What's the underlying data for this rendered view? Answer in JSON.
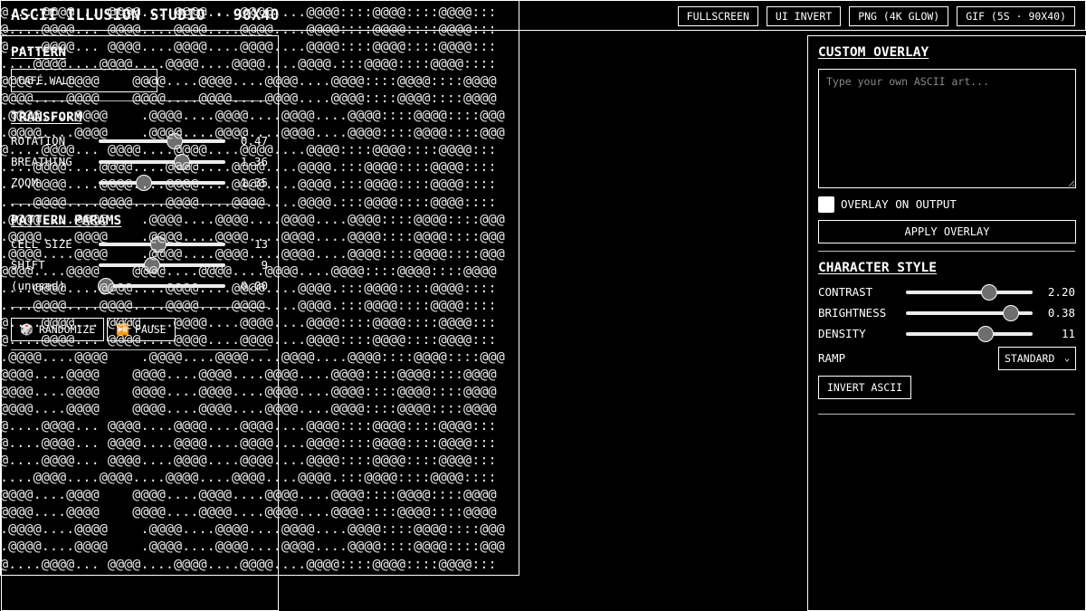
{
  "app": {
    "title": "ASCII ILLUSION STUDIO · 90X40"
  },
  "toolbar": {
    "fullscreen": "FULLSCREEN",
    "ui_invert": "UI INVERT",
    "png": "PNG (4K GLOW)",
    "gif": "GIF (5S · 90X40)"
  },
  "left": {
    "pattern": {
      "title": "PATTERN",
      "selected": "CAFÉ WALL"
    },
    "transform": {
      "title": "TRANSFORM",
      "rows": [
        {
          "label": "ROTATION",
          "value": "0.47",
          "fraction": 0.6
        },
        {
          "label": "BREATHING",
          "value": "1.36",
          "fraction": 0.66
        },
        {
          "label": "ZOOM",
          "value": "1.35",
          "fraction": 0.36
        }
      ]
    },
    "params": {
      "title": "PATTERN PARAMS",
      "rows": [
        {
          "label": "CELL SIZE",
          "value": "13",
          "fraction": 0.47
        },
        {
          "label": "SHIFT",
          "value": "9",
          "fraction": 0.42
        },
        {
          "label": "(unused)",
          "value": "0.00",
          "fraction": 0.06
        }
      ]
    },
    "actions": {
      "randomize": "RANDOMIZE",
      "randomize_icon": "🎲",
      "pause": "PAUSE",
      "pause_icon": "⏯️"
    }
  },
  "canvas": {
    "lines": [
      "@....@@@@... @@@@....@@@@....@@@@....@@@@::::@@@@::::@@@@:::",
      "@....@@@@... @@@@....@@@@....@@@@....@@@@::::@@@@::::@@@@:::",
      "@....@@@@... @@@@....@@@@....@@@@....@@@@::::@@@@::::@@@@:::",
      "....@@@@....@@@@....@@@@....@@@@....@@@@.:::@@@@::::@@@@::::",
      "@@@@....@@@@    @@@@....@@@@....@@@@....@@@@::::@@@@::::@@@@",
      "@@@@....@@@@    @@@@....@@@@....@@@@....@@@@::::@@@@::::@@@@",
      ".@@@@....@@@@    .@@@@....@@@@....@@@@....@@@@::::@@@@::::@@@",
      ".@@@@....@@@@    .@@@@....@@@@....@@@@....@@@@::::@@@@::::@@@",
      "@....@@@@... @@@@....@@@@....@@@@....@@@@::::@@@@::::@@@@:::",
      "....@@@@....@@@@....@@@@....@@@@....@@@@.:::@@@@::::@@@@::::",
      "....@@@@....@@@@....@@@@....@@@@....@@@@.:::@@@@::::@@@@::::",
      "....@@@@....@@@@....@@@@....@@@@....@@@@.:::@@@@::::@@@@::::",
      ".@@@@....@@@@    .@@@@....@@@@....@@@@....@@@@::::@@@@::::@@@",
      ".@@@@....@@@@    .@@@@....@@@@....@@@@....@@@@::::@@@@::::@@@",
      ".@@@@....@@@@    .@@@@....@@@@....@@@@....@@@@::::@@@@::::@@@",
      "@@@@....@@@@    @@@@....@@@@....@@@@....@@@@::::@@@@::::@@@@",
      "....@@@@....@@@@....@@@@....@@@@....@@@@.:::@@@@::::@@@@::::",
      "....@@@@....@@@@....@@@@....@@@@....@@@@.:::@@@@::::@@@@::::",
      "@....@@@@... @@@@....@@@@....@@@@....@@@@::::@@@@::::@@@@:::",
      "@....@@@@... @@@@....@@@@....@@@@....@@@@::::@@@@::::@@@@:::",
      ".@@@@....@@@@    .@@@@....@@@@....@@@@....@@@@::::@@@@::::@@@",
      "@@@@....@@@@    @@@@....@@@@....@@@@....@@@@::::@@@@::::@@@@",
      "@@@@....@@@@    @@@@....@@@@....@@@@....@@@@::::@@@@::::@@@@",
      "@@@@....@@@@    @@@@....@@@@....@@@@....@@@@::::@@@@::::@@@@",
      "@....@@@@... @@@@....@@@@....@@@@....@@@@::::@@@@::::@@@@:::",
      "@....@@@@... @@@@....@@@@....@@@@....@@@@::::@@@@::::@@@@:::",
      "@....@@@@... @@@@....@@@@....@@@@....@@@@::::@@@@::::@@@@:::",
      "....@@@@....@@@@....@@@@....@@@@....@@@@.:::@@@@::::@@@@::::",
      "@@@@....@@@@    @@@@....@@@@....@@@@....@@@@::::@@@@::::@@@@",
      "@@@@....@@@@    @@@@....@@@@....@@@@....@@@@::::@@@@::::@@@@",
      ".@@@@....@@@@    .@@@@....@@@@....@@@@....@@@@::::@@@@::::@@@",
      ".@@@@....@@@@    .@@@@....@@@@....@@@@....@@@@::::@@@@::::@@@",
      "@....@@@@... @@@@....@@@@....@@@@....@@@@::::@@@@::::@@@@:::"
    ]
  },
  "right": {
    "overlay": {
      "title": "CUSTOM OVERLAY",
      "placeholder": "Type your own ASCII art...",
      "checkbox_label": "OVERLAY ON OUTPUT",
      "apply": "APPLY OVERLAY"
    },
    "style": {
      "title": "CHARACTER STYLE",
      "rows": [
        {
          "label": "CONTRAST",
          "value": "2.20",
          "fraction": 0.66
        },
        {
          "label": "BRIGHTNESS",
          "value": "0.38",
          "fraction": 0.83
        },
        {
          "label": "DENSITY",
          "value": "11",
          "fraction": 0.63
        }
      ],
      "ramp_label": "RAMP",
      "ramp_selected": "STANDARD",
      "invert": "INVERT ASCII"
    }
  }
}
